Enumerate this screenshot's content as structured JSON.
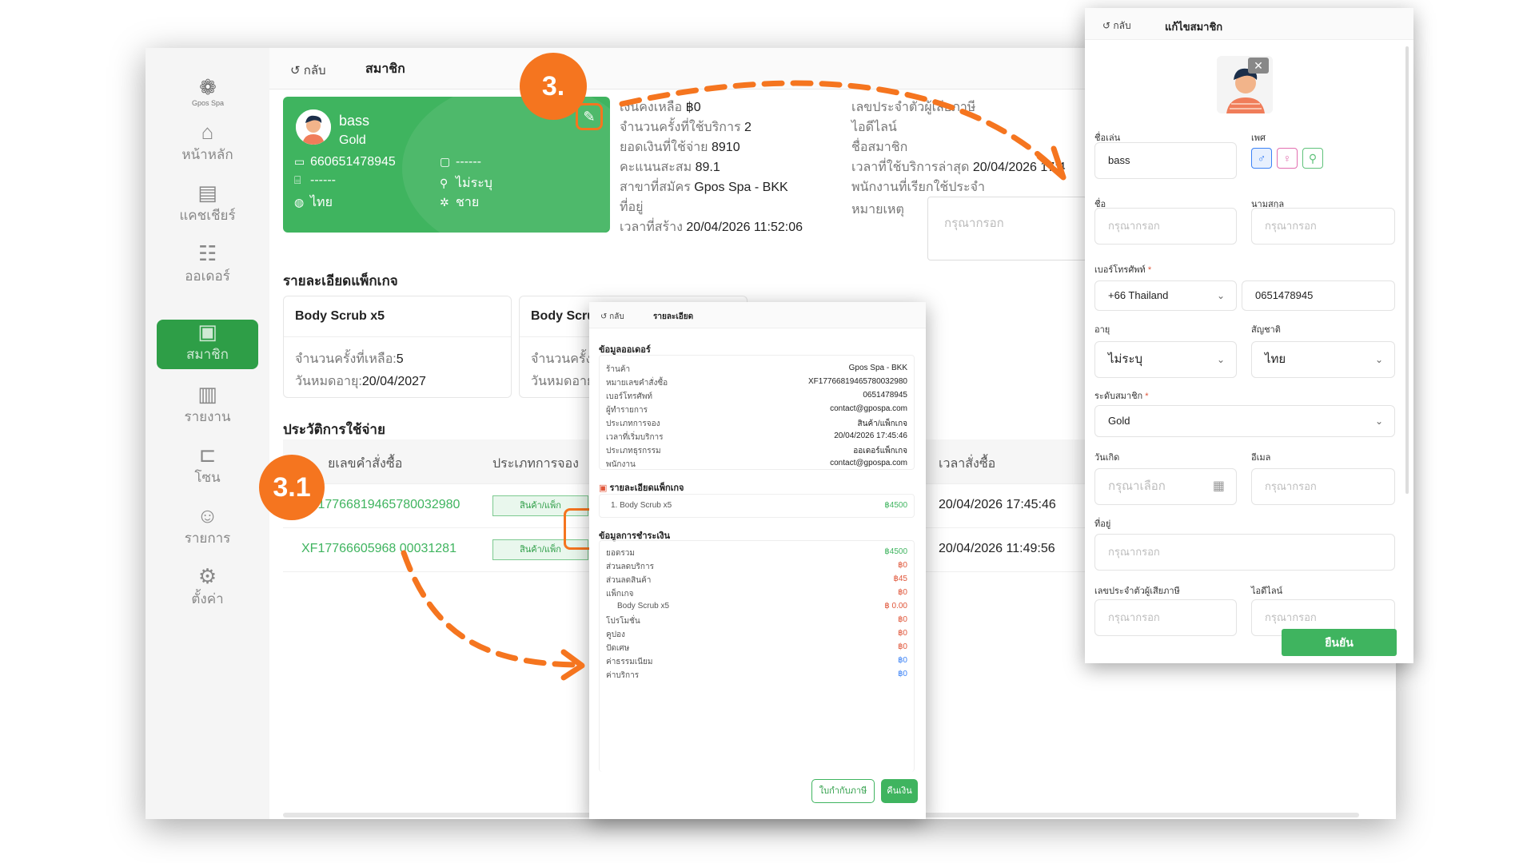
{
  "sidebar": {
    "logo_text": "Gpos Spa",
    "items": [
      {
        "label": "หน้าหลัก",
        "icon": "home-icon"
      },
      {
        "label": "แคชเชียร์",
        "icon": "cashier-icon"
      },
      {
        "label": "ออเดอร์",
        "icon": "clipboard-icon"
      },
      {
        "label": "สมาชิก",
        "icon": "member-icon"
      },
      {
        "label": "รายงาน",
        "icon": "chart-icon"
      },
      {
        "label": "โซน",
        "icon": "zone-icon"
      },
      {
        "label": "รายการ",
        "icon": "list-icon"
      },
      {
        "label": "ตั้งค่า",
        "icon": "gear-icon"
      }
    ],
    "active_index": 3
  },
  "topbar": {
    "back_label": "กลับ",
    "title": "สมาชิก"
  },
  "member_card": {
    "name": "bass",
    "level": "Gold",
    "member_id": "660651478945",
    "field_a": "------",
    "field_b": "------",
    "gender": "ไม่ระบุ",
    "language": "ไทย",
    "sex": "ชาย",
    "accent_color": "#3fb45f"
  },
  "info": {
    "balance_label": "เงินคงเหลือ",
    "balance": "฿0",
    "visits_label": "จำนวนครั้งที่ใช้บริการ",
    "visits": "2",
    "spent_label": "ยอดเงินที่ใช้จ่าย",
    "spent": "8910",
    "points_label": "คะแนนสะสม",
    "points": "89.1",
    "branch_label": "สาขาที่สมัคร",
    "branch": "Gpos Spa - BKK",
    "address_label": "ที่อยู่",
    "created_label": "เวลาที่สร้าง",
    "created": "20/04/2026 11:52:06",
    "tax_label": "เลขประจำตัวผู้เสียภาษี",
    "line_label": "ไอดีไลน์",
    "member_name_label": "ชื่อสมาชิก",
    "last_visit_label": "เวลาที่ใช้บริการล่าสุด",
    "last_visit": "20/04/2026 17:4",
    "staff_label": "พนักงานที่เรียกใช้ประจำ",
    "remark_label": "หมายเหตุ",
    "remark_placeholder": "กรุณากรอก"
  },
  "packages": {
    "title": "รายละเอียดแพ็กเกจ",
    "items": [
      {
        "name": "Body Scrub x5",
        "remaining_label": "จำนวนครั้งที่เหลือ:",
        "remaining": "5",
        "expire_label": "วันหมดอายุ:",
        "expire": "20/04/2027"
      },
      {
        "name": "Body Scru",
        "remaining_label": "จำนวนครั้ง",
        "remaining": "",
        "expire_label": "วันหมดอาย",
        "expire": ""
      }
    ]
  },
  "history": {
    "title": "ประวัติการใช้จ่าย",
    "columns": [
      "ยเลขคำสั่งซื้อ",
      "ประเภทการจอง",
      "เวลาสั่งซื้อ"
    ],
    "rows": [
      {
        "order_id": "XF17766819465780032980",
        "type": "สินค้า/แพ็ก",
        "time": "20/04/2026 17:45:46"
      },
      {
        "order_id": "XF17766605968 00031281",
        "type": "สินค้า/แพ็ก",
        "time": "20/04/2026 11:49:56"
      }
    ]
  },
  "detail_popup": {
    "back_label": "กลับ",
    "title": "รายละเอียด",
    "order_section": "ข้อมูลออเดอร์",
    "order_rows": [
      {
        "k": "ร้านค้า",
        "v": "Gpos Spa - BKK"
      },
      {
        "k": "หมายเลขคำสั่งซื้อ",
        "v": "XF17766819465780032980"
      },
      {
        "k": "เบอร์โทรศัพท์",
        "v": "0651478945"
      },
      {
        "k": "ผู้ทำรายการ",
        "v": "contact@gpospa.com"
      },
      {
        "k": "ประเภทการจอง",
        "v": "สินค้า/แพ็กเกจ"
      },
      {
        "k": "เวลาที่เริ่มบริการ",
        "v": "20/04/2026 17:45:46"
      },
      {
        "k": "ประเภทธุรกรรม",
        "v": "ออเดอร์แพ็กเกจ"
      },
      {
        "k": "พนักงาน",
        "v": "contact@gpospa.com"
      }
    ],
    "package_section": "รายละเอียดแพ็กเกจ",
    "package_line_no": "1.",
    "package_line_name": "Body Scrub x5",
    "package_line_price": "฿4500",
    "payment_section": "ข้อมูลการชำระเงิน",
    "payment_rows": [
      {
        "k": "ยอดรวม",
        "v": "฿4500",
        "c": "green"
      },
      {
        "k": "ส่วนลดบริการ",
        "v": "฿0",
        "c": "red"
      },
      {
        "k": "ส่วนลดสินค้า",
        "v": "฿45",
        "c": "red"
      },
      {
        "k": "แพ็กเกจ",
        "v": "฿0",
        "c": "red"
      },
      {
        "k": "Body Scrub x5",
        "v": "฿ 0.00",
        "c": "red",
        "indent": true
      },
      {
        "k": "โปรโมชั่น",
        "v": "฿0",
        "c": "red"
      },
      {
        "k": "คูปอง",
        "v": "฿0",
        "c": "red"
      },
      {
        "k": "ปัดเศษ",
        "v": "฿0",
        "c": "red"
      },
      {
        "k": "ค่าธรรมเนียม",
        "v": "฿0",
        "c": "blue"
      },
      {
        "k": "ค่าบริการ",
        "v": "฿0",
        "c": "blue"
      }
    ],
    "receipt_label": "ใบกำกับภาษี",
    "refund_label": "คืนเงิน"
  },
  "edit_popup": {
    "back_label": "กลับ",
    "title": "แก้ไขสมาชิก",
    "nickname_label": "ชื่อเล่น",
    "nickname": "bass",
    "gender_label": "เพศ",
    "firstname_label": "ชื่อ",
    "firstname_placeholder": "กรุณากรอก",
    "lastname_label": "นามสกุล",
    "lastname_placeholder": "กรุณากรอก",
    "phone_label": "เบอร์โทรศัพท์",
    "country_code": "+66 Thailand",
    "phone": "0651478945",
    "age_label": "อายุ",
    "age": "ไม่ระบุ",
    "nationality_label": "สัญชาติ",
    "nationality": "ไทย",
    "level_label": "ระดับสมาชิก",
    "level": "Gold",
    "birthday_label": "วันเกิด",
    "birthday_placeholder": "กรุณาเลือก",
    "email_label": "อีเมล",
    "email_placeholder": "กรุณากรอก",
    "address_label": "ที่อยู่",
    "address_placeholder": "กรุณากรอก",
    "tax_label": "เลขประจำตัวผู้เสียภาษี",
    "tax_placeholder": "กรุณากรอก",
    "line_label": "ไอดีไลน์",
    "line_placeholder": "กรุณากรอก",
    "required_mark": "*",
    "confirm_label": "ยืนยัน"
  },
  "annotations": {
    "step_a": "3.",
    "step_b": "3.1",
    "color": "#f5751f"
  }
}
